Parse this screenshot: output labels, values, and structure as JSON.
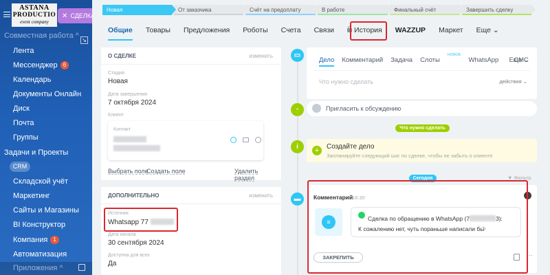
{
  "sidebar": {
    "logo": {
      "line1": "ASTANA",
      "line2": "PRODUCTIO",
      "line3": "event company"
    },
    "deal_tab": "СДЕЛКА",
    "section": "Совместная работа ^",
    "items": [
      {
        "label": "Лента"
      },
      {
        "label": "Мессенджер",
        "badge": "6"
      },
      {
        "label": "Календарь"
      },
      {
        "label": "Документы Онлайн"
      },
      {
        "label": "Диск"
      },
      {
        "label": "Почта"
      },
      {
        "label": "Группы"
      },
      {
        "label": "Задачи и Проекты"
      },
      {
        "label": "CRM"
      },
      {
        "label": "Складской учёт"
      },
      {
        "label": "Маркетинг"
      },
      {
        "label": "Сайты и Магазины"
      },
      {
        "label": "BI Конструктор"
      },
      {
        "label": "Компания",
        "badge": "1"
      },
      {
        "label": "Автоматизация"
      }
    ],
    "apps": "Приложения ^"
  },
  "stages": [
    "Новая",
    "От заказчика",
    "Счёт на предоплату",
    "В работе",
    "Финальный счёт",
    "Завершить сделку"
  ],
  "tabs": [
    "Общие",
    "Товары",
    "Предложения",
    "Роботы",
    "Счета",
    "Связи",
    "История",
    "WAZZUP",
    "Маркет",
    "Еще ⌄"
  ],
  "about": {
    "title": "О СДЕЛКЕ",
    "edit": "изменить",
    "stage_label": "Стадия",
    "stage_value": "Новая",
    "close_label": "Дата завершения",
    "close_value": "7 октября 2024",
    "client_label": "Клиент",
    "contact_label": "Контакт",
    "select_field": "Выбрать поле",
    "create_field": "Создать поле",
    "delete_section": "Удалить раздел"
  },
  "extra": {
    "title": "ДОПОЛНИТЕЛЬНО",
    "edit": "изменить",
    "source_label": "Источник",
    "source_value": "Whatsapp 77",
    "start_label": "Дата начала",
    "start_value": "30 сентября 2024",
    "access_label": "Доступна для всех",
    "access_value": "Да"
  },
  "activity": {
    "tabs": [
      "Дело",
      "Комментарий",
      "Задача",
      "Слоты",
      "WhatsApp",
      "СМС"
    ],
    "new_tag": "НОВОЕ",
    "more": "Еще ⌄",
    "placeholder": "Что нужно сделать",
    "actions": "действия ⌄"
  },
  "invite": "Пригласить к обсуждению",
  "todo_pill": "Что нужно сделать",
  "create": {
    "title": "Создайте дело",
    "hint": "Запланируйте следующий шаг по сделке, чтобы не забыть о клиенте"
  },
  "today_pill": "Сегодня",
  "filter": "Фильтр",
  "comment": {
    "title": "Комментарий",
    "time": "18:30",
    "line1": "Сделка по обращению в WhatsApp (7",
    "line1_end": "3):",
    "line2": "К сожалению нет, чуть пораньше написали бы",
    "pin": "ЗАКРЕПИТЬ"
  },
  "colors": {
    "accent": "#2fc6f6",
    "highlight": "#d9262e",
    "green": "#9dcf00",
    "sidebar": "#1f5fb5"
  }
}
